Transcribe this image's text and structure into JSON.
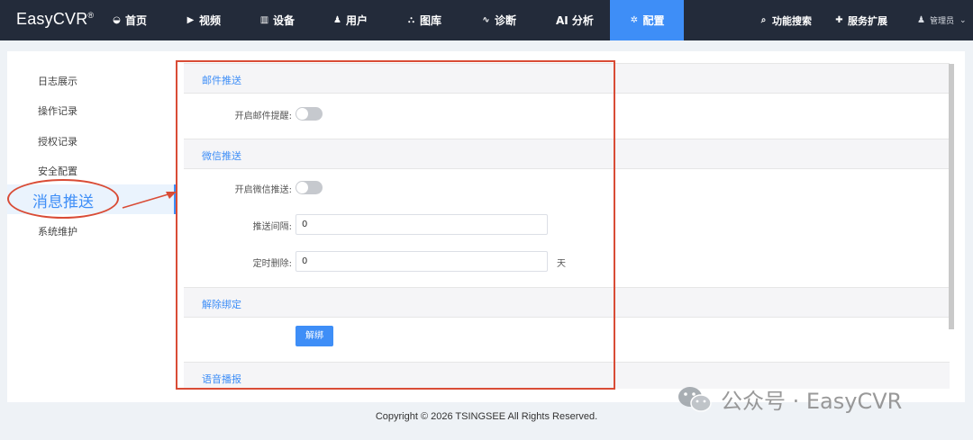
{
  "brand": {
    "name": "EasyCVR",
    "mark": "®"
  },
  "nav": {
    "items": [
      {
        "icon": "dashboard-icon",
        "glyph": "◒",
        "label": "首页"
      },
      {
        "icon": "play-icon",
        "glyph": "▶",
        "label": "视频"
      },
      {
        "icon": "device-icon",
        "glyph": "▥",
        "label": "设备"
      },
      {
        "icon": "user-icon",
        "glyph": "♟",
        "label": "用户"
      },
      {
        "icon": "gallery-icon",
        "glyph": "⛬",
        "label": "图库"
      },
      {
        "icon": "pulse-icon",
        "glyph": "∿",
        "label": "诊断"
      },
      {
        "icon": "ai-icon",
        "glyph": "",
        "label": "AI 分析"
      },
      {
        "icon": "gear-icon",
        "glyph": "✲",
        "label": "配置"
      }
    ],
    "active_index": 7,
    "right": [
      {
        "icon": "search-icon",
        "glyph": "⌕",
        "label": "功能搜索"
      },
      {
        "icon": "puzzle-icon",
        "glyph": "✚",
        "label": "服务扩展"
      }
    ],
    "user": {
      "icon": "user-icon",
      "glyph": "♟",
      "label": "管理员",
      "caret": "⌄"
    }
  },
  "sidebar": {
    "items": [
      "日志展示",
      "操作记录",
      "授权记录",
      "安全配置",
      "消息推送",
      "系统维护"
    ],
    "active": "消息推送"
  },
  "sections": {
    "mail": {
      "title": "邮件推送",
      "toggle_label": "开启邮件提醒:",
      "enabled": false
    },
    "wechat": {
      "title": "微信推送",
      "toggle_label": "开启微信推送:",
      "enabled": false,
      "interval_label": "推送间隔:",
      "interval_value": "0",
      "delete_label": "定时删除:",
      "delete_value": "0",
      "delete_unit": "天"
    },
    "unbind": {
      "title": "解除绑定",
      "button": "解绑"
    },
    "voice": {
      "title": "语音播报"
    }
  },
  "colors": {
    "accent": "#3e8ef7",
    "topbar": "#232b3a",
    "annotation": "#d94c36"
  },
  "footer": {
    "copyright": "Copyright © 2026 TSINGSEE All Rights Reserved."
  },
  "watermark": {
    "text": "公众号 · EasyCVR"
  }
}
